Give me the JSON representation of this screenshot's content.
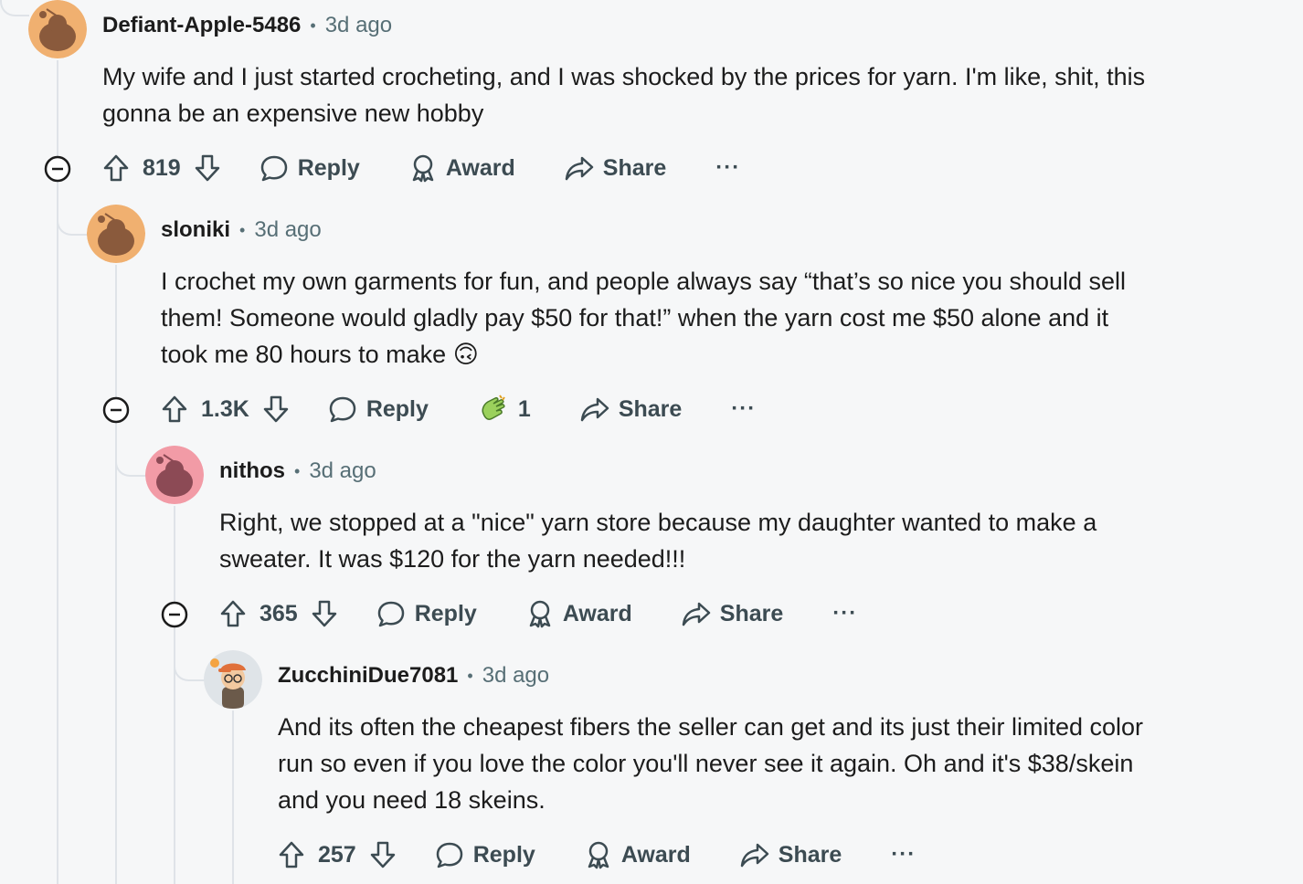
{
  "comments": [
    {
      "username": "Defiant-Apple-5486",
      "time": "3d ago",
      "lines": [
        "My wife and I just started crocheting, and I was shocked by the prices for yarn. I'm like, shit, this",
        "gonna be an expensive new hobby"
      ],
      "votes": "819",
      "reply_label": "Reply",
      "award_label": "Award",
      "share_label": "Share",
      "more_label": "···",
      "avatar_color": "#f0b070"
    },
    {
      "username": "sloniki",
      "time": "3d ago",
      "lines": [
        "I crochet my own garments for fun, and people always say “that’s so nice you should sell",
        "them! Someone would gladly pay $50 for that!” when the yarn cost me $50 alone and it",
        "took me 80 hours to make"
      ],
      "emoji": "🙃",
      "votes": "1.3K",
      "reply_label": "Reply",
      "award_count": "1",
      "share_label": "Share",
      "more_label": "···",
      "avatar_color": "#f0b070"
    },
    {
      "username": "nithos",
      "time": "3d ago",
      "lines": [
        "Right, we stopped at a \"nice\" yarn store because my daughter wanted to make a",
        "sweater. It was $120 for the yarn needed!!!"
      ],
      "votes": "365",
      "reply_label": "Reply",
      "award_label": "Award",
      "share_label": "Share",
      "more_label": "···",
      "avatar_color": "#f29ba6"
    },
    {
      "username": "ZucchiniDue7081",
      "time": "3d ago",
      "lines": [
        "And its often the cheapest fibers the seller can get and its just their limited color",
        "run so even if you love the color you'll never see it again. Oh and it's $38/skein",
        "and you need 18 skeins."
      ],
      "votes": "257",
      "reply_label": "Reply",
      "award_label": "Award",
      "share_label": "Share",
      "more_label": "···",
      "avatar_color": "#dfe4e8"
    }
  ]
}
